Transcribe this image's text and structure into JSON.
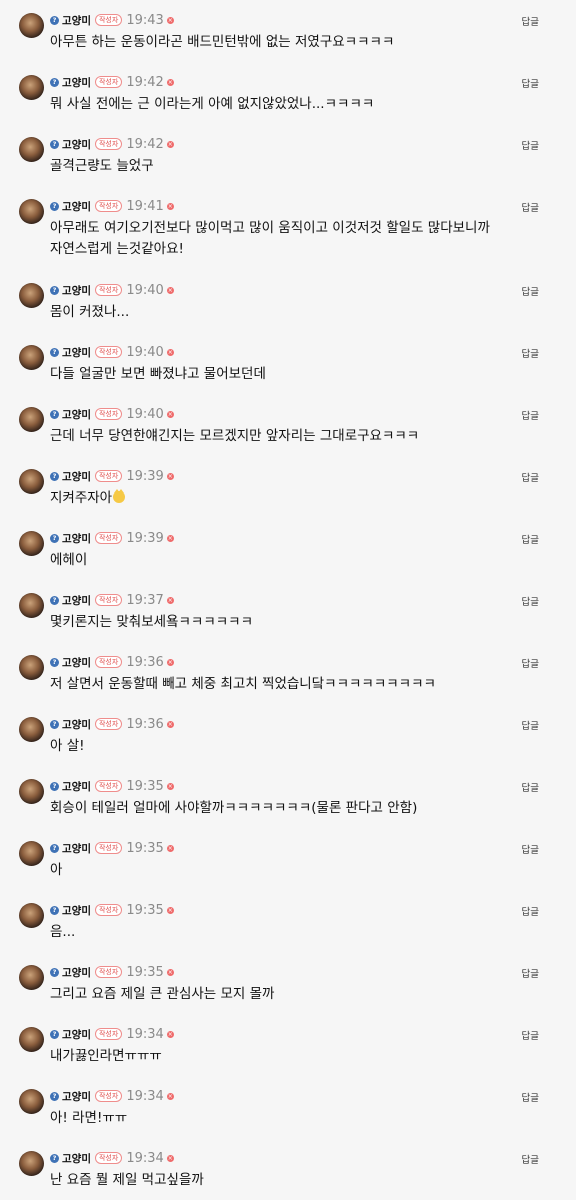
{
  "author_badge": "작성자",
  "reply_label": "답글",
  "level_icon": "info-level-icon",
  "delete_icon": "x-circle-icon",
  "comments": [
    {
      "nickname": "고양미",
      "time": "19:43",
      "text": "아무튼 하는 운동이라곤 배드민턴밖에 없는 저였구요ㅋㅋㅋㅋ"
    },
    {
      "nickname": "고양미",
      "time": "19:42",
      "text": "뭐 사실 전에는 근 이라는게 아예 없지않았었나...ㅋㅋㅋㅋ"
    },
    {
      "nickname": "고양미",
      "time": "19:42",
      "text": "골격근량도 늘었구"
    },
    {
      "nickname": "고양미",
      "time": "19:41",
      "text": "아무래도 여기오기전보다 많이먹고 많이 움직이고 이것저것 할일도 많다보니까 자연스럽게 는것같아요!"
    },
    {
      "nickname": "고양미",
      "time": "19:40",
      "text": "몸이 커졌나..."
    },
    {
      "nickname": "고양미",
      "time": "19:40",
      "text": "다들 얼굴만 보면 빠졌냐고 물어보던데"
    },
    {
      "nickname": "고양미",
      "time": "19:40",
      "text": "근데 너무 당연한얘긴지는 모르겠지만 앞자리는 그대로구요ㅋㅋㅋ"
    },
    {
      "nickname": "고양미",
      "time": "19:39",
      "text": "지켜주자아"
    },
    {
      "nickname": "고양미",
      "time": "19:39",
      "text": "에헤이"
    },
    {
      "nickname": "고양미",
      "time": "19:37",
      "text": "몇키론지는 맞춰보세욬ㅋㅋㅋㅋㅋㅋ"
    },
    {
      "nickname": "고양미",
      "time": "19:36",
      "text": "저 살면서 운동할때 빼고 체중 최고치 찍었습니닼ㅋㅋㅋㅋㅋㅋㅋㅋㅋ"
    },
    {
      "nickname": "고양미",
      "time": "19:36",
      "text": "아 살!"
    },
    {
      "nickname": "고양미",
      "time": "19:35",
      "text": "회승이 테일러 얼마에 사야할까ㅋㅋㅋㅋㅋㅋㅋ(물론 판다고 안함)"
    },
    {
      "nickname": "고양미",
      "time": "19:35",
      "text": "아"
    },
    {
      "nickname": "고양미",
      "time": "19:35",
      "text": "음..."
    },
    {
      "nickname": "고양미",
      "time": "19:35",
      "text": "그리고 요즘 제일 큰 관심사는 모지 몰까"
    },
    {
      "nickname": "고양미",
      "time": "19:34",
      "text": "내가끓인라면ㅠㅠㅠ"
    },
    {
      "nickname": "고양미",
      "time": "19:34",
      "text": "아! 라면!ㅠㅠ"
    },
    {
      "nickname": "고양미",
      "time": "19:34",
      "text": "난 요즘 뭘 제일 먹고싶을까"
    }
  ]
}
